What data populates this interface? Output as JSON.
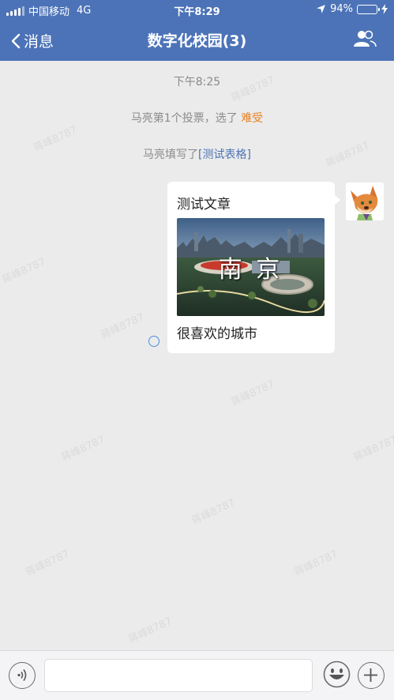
{
  "status_bar": {
    "carrier": "中国移动",
    "network": "4G",
    "time": "下午8:29",
    "battery_percent": "94%",
    "battery_level": 0.94
  },
  "nav": {
    "back_label": "消息",
    "title": "数字化校园(3)"
  },
  "chat": {
    "timestamp": "下午8:25",
    "vote_notice_prefix": "马亮第1个投票，选了",
    "vote_choice": "难受",
    "form_notice_prefix": "马亮填写了",
    "form_link": "[测试表格]",
    "message": {
      "title": "测试文章",
      "image_caption": "南 京",
      "text": "很喜欢的城市"
    },
    "watermark": "蒋峰8787"
  },
  "input_bar": {
    "placeholder": ""
  },
  "colors": {
    "nav_bg": "#4c73b7",
    "highlight": "#e8811f",
    "link": "#4c73b7",
    "chat_bg": "#ebebeb"
  }
}
